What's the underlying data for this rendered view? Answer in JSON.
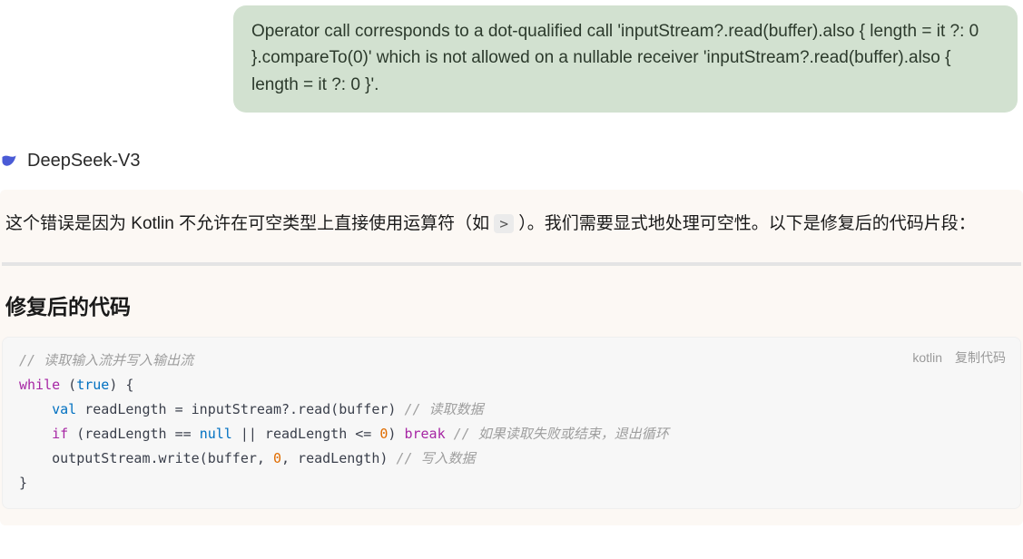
{
  "user_message": "Operator call corresponds to a dot-qualified call 'inputStream?.read(buffer).also { length = it ?: 0 }.compareTo(0)' which is not allowed on a nullable receiver 'inputStream?.read(buffer).also { length = it ?: 0 }'.",
  "ai": {
    "name": "DeepSeek-V3"
  },
  "answer": {
    "intro_pre": "这个错误是因为 Kotlin 不允许在可空类型上直接使用运算符（如 ",
    "intro_code": ">",
    "intro_post": " ）。我们需要显式地处理可空性。以下是修复后的代码片段：",
    "heading": "修复后的代码",
    "code_lang": "kotlin",
    "copy_label": "复制代码",
    "code": {
      "c1": "// 读取输入流并写入输出流",
      "kw_while": "while",
      "lit_true": "true",
      "l2_tail": ") {",
      "kw_val": "val",
      "l3_mid": " readLength = inputStream?.read(buffer) ",
      "c3": "// 读取数据",
      "kw_if": "if",
      "l4_a": " (readLength == ",
      "kw_null": "null",
      "l4_b": " || readLength <= ",
      "num_zero": "0",
      "l4_c": ") ",
      "kw_break": "break",
      "c4": "// 如果读取失败或结束，退出循环",
      "l5_a": "    outputStream.write(buffer, ",
      "l5_b": ", readLength) ",
      "c5": "// 写入数据",
      "l6": "}"
    }
  }
}
